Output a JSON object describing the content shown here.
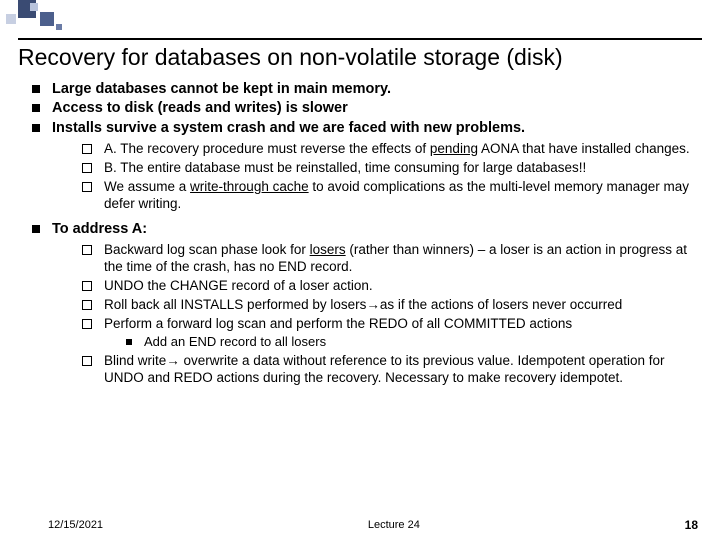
{
  "slide": {
    "title": "Recovery for databases on non-volatile storage (disk)",
    "bullets": {
      "b1": "Large databases cannot be kept in main memory.",
      "b2": "Access to disk (reads and writes) is slower",
      "b3": "Installs survive a system crash and  we are faced with new problems.",
      "b3_sub": {
        "a_pre": "A. The recovery procedure must reverse the effects of ",
        "a_underline": "pending",
        "a_post": " AONA that have installed changes.",
        "b": "B. The entire database must be reinstalled, time consuming for large databases!!",
        "c_pre": "We assume a ",
        "c_underline": "write-through cache",
        "c_post": " to avoid complications as  the multi-level memory manager may defer writing."
      },
      "b4": "To address A:",
      "b4_sub": {
        "s1_pre": "Backward log scan phase look for ",
        "s1_u": "losers",
        "s1_post": " (rather than winners) – a loser is an action in progress at the time of the crash, has no END record.",
        "s2": "UNDO the CHANGE record of a loser action.",
        "s3_pre": "Roll back all INSTALLS performed by losers",
        "s3_arrow": "→",
        "s3_post": "as if the actions of losers never occurred",
        "s4": "Perform a forward log scan and perform the REDO of all  COMMITTED actions",
        "s4_sub": "Add an END record to all losers",
        "s5_pre": "Blind write",
        "s5_arrow": "→",
        "s5_post": " overwrite a data without reference to its previous value. Idempotent operation for UNDO and REDO actions during the recovery. Necessary to make recovery idempotet."
      }
    }
  },
  "footer": {
    "date": "12/15/2021",
    "lecture": "Lecture 24",
    "page": "18"
  }
}
